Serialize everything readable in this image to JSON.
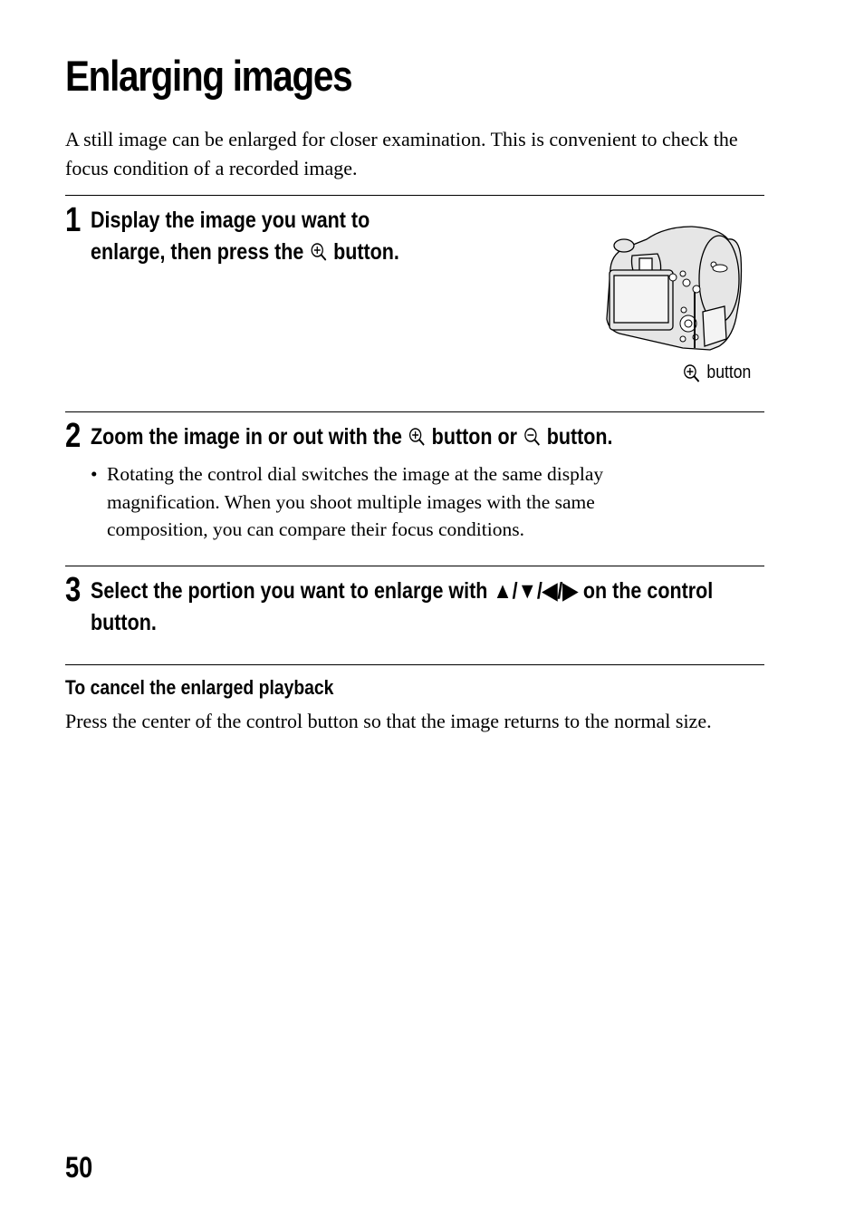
{
  "page": {
    "title": "Enlarging images",
    "intro": "A still image can be enlarged for closer examination. This is convenient to check the focus condition of a recorded image.",
    "page_number": "50"
  },
  "steps": [
    {
      "number": "1",
      "text_before_icon": "Display the image you want to enlarge, then press the",
      "icon": "zoom-in-icon",
      "text_after_icon": "button.",
      "figure_caption": "button",
      "figure_caption_icon": "zoom-in-icon"
    },
    {
      "number": "2",
      "text_part1": "Zoom the image in or out with the",
      "icon1": "zoom-in-icon",
      "text_part2": "button or",
      "icon2": "zoom-out-icon",
      "text_part3": "button.",
      "bullet": "Rotating the control dial switches the image at the same display magnification. When you shoot multiple images with the same composition, you can compare their focus conditions."
    },
    {
      "number": "3",
      "text": "Select the portion you want to enlarge with ▲/▼/◀/▶ on the control button."
    }
  ],
  "cancel": {
    "heading": "To cancel the enlarged playback",
    "body": "Press the center of the control button so that the image returns to the normal size."
  }
}
